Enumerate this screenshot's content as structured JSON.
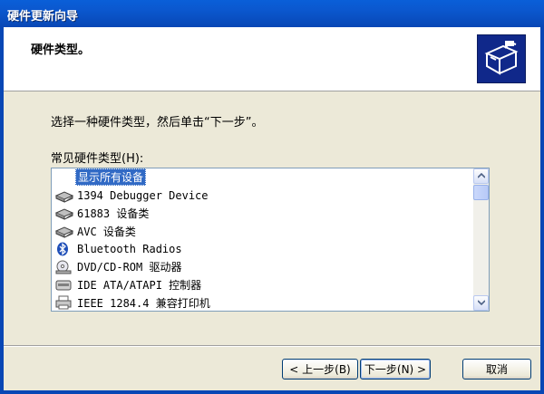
{
  "window": {
    "title": "硬件更新向导"
  },
  "header": {
    "heading": "硬件类型。",
    "icon": "hardware-wizard-icon"
  },
  "main": {
    "instruction": "选择一种硬件类型，然后单击“下一步”。",
    "list_label": "常见硬件类型",
    "list_label_hotkey": "(H):",
    "items": [
      {
        "label": "显示所有设备",
        "icon": "none",
        "selected": true
      },
      {
        "label": "1394 Debugger Device",
        "icon": "device-icon"
      },
      {
        "label": "61883 设备类",
        "icon": "device-icon"
      },
      {
        "label": "AVC 设备类",
        "icon": "device-icon"
      },
      {
        "label": "Bluetooth Radios",
        "icon": "bluetooth-icon"
      },
      {
        "label": "DVD/CD-ROM 驱动器",
        "icon": "cdrom-icon"
      },
      {
        "label": "IDE ATA/ATAPI 控制器",
        "icon": "ide-controller-icon"
      },
      {
        "label": "IEEE 1284.4 兼容打印机",
        "icon": "printer-icon"
      }
    ]
  },
  "buttons": {
    "back": "< 上一步(B)",
    "next": "下一步(N) >",
    "cancel": "取消"
  },
  "colors": {
    "titlebar": "#0a5fd8",
    "selection": "#316ac5",
    "face": "#ece9d8"
  }
}
